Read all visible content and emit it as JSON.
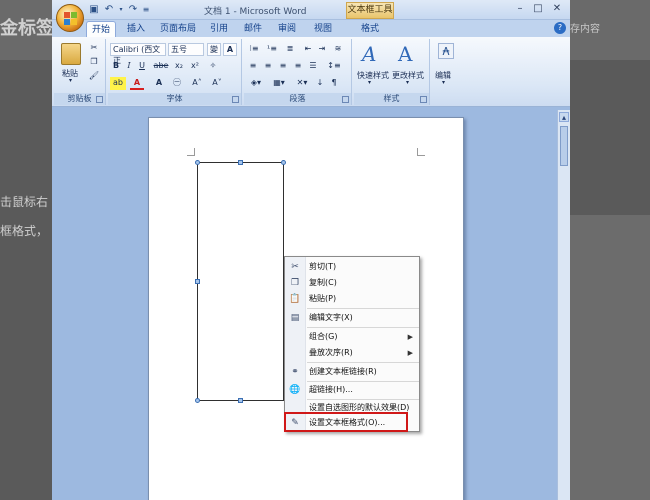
{
  "background": {
    "title_fragment": "金标签",
    "right_text": "存内容",
    "line1": "击鼠标右",
    "line2": "框格式，"
  },
  "window": {
    "title": "文档 1 - Microsoft Word",
    "context_tool": "文本框工具",
    "qat": [
      "save-icon",
      "undo-icon",
      "redo-icon",
      "customize-icon"
    ],
    "controls": {
      "minimize": "–",
      "maximize": "□",
      "close": "✕"
    }
  },
  "tabs": [
    "开始",
    "插入",
    "页面布局",
    "引用",
    "邮件",
    "审阅",
    "视图",
    "格式"
  ],
  "ribbon": {
    "clipboard": {
      "label": "剪贴板",
      "paste": "粘贴"
    },
    "font": {
      "label": "字体",
      "font_name": "Calibri (西文正",
      "font_size": "五号"
    },
    "paragraph": {
      "label": "段落"
    },
    "styles": {
      "label": "样式",
      "quick_styles": "快速样式",
      "change_styles": "更改样式"
    },
    "editing": {
      "label": "编辑"
    }
  },
  "context_menu": {
    "items": [
      {
        "label": "剪切(T)",
        "icon": "scissors-icon",
        "glyph": "✂"
      },
      {
        "label": "复制(C)",
        "icon": "copy-icon",
        "glyph": "❐"
      },
      {
        "label": "粘贴(P)",
        "icon": "paste-icon",
        "glyph": "📋"
      },
      {
        "label": "编辑文字(X)",
        "icon": "edit-text-icon",
        "glyph": "▤"
      },
      {
        "label": "组合(G)",
        "icon": "",
        "glyph": ""
      },
      {
        "label": "叠放次序(R)",
        "icon": "",
        "glyph": ""
      },
      {
        "label": "创建文本框链接(R)",
        "icon": "link-icon",
        "glyph": "⚭"
      },
      {
        "label": "超链接(H)...",
        "icon": "globe-icon",
        "glyph": "🌐"
      },
      {
        "label": "设置自选图形的默认效果(D)",
        "icon": "",
        "glyph": ""
      },
      {
        "label": "设置文本框格式(O)...",
        "icon": "format-textbox-icon",
        "glyph": "✎"
      }
    ]
  }
}
